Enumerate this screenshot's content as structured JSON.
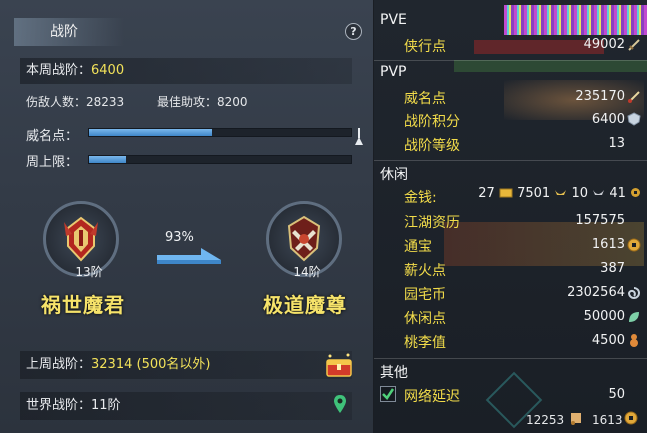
{
  "left": {
    "title": "战阶",
    "help_label": "?",
    "weekly_label": "本周战阶：",
    "weekly_value": "6400",
    "enemies_text": "伤敌人数：28233",
    "assist_text": "最佳助攻：8200",
    "fame_label": "威名点：",
    "fame_fill": 0.47,
    "cap_label": "周上限：",
    "cap_fill": 0.14,
    "current_rank_level": "13阶",
    "current_rank_name": "祸世魔君",
    "progress_pct": "93%",
    "next_rank_level": "14阶",
    "next_rank_name": "极道魔尊",
    "last_week_label": "上周战阶：",
    "last_week_value": "32314 (500名以外)",
    "world_label": "世界战阶：",
    "world_value": "11阶"
  },
  "right": {
    "pve": {
      "header": "PVE",
      "items": [
        {
          "label": "侠行点",
          "value": "49002",
          "icon": "sword-icon"
        }
      ]
    },
    "pvp": {
      "header": "PVP",
      "items": [
        {
          "label": "威名点",
          "value": "235170",
          "icon": "blade-icon"
        },
        {
          "label": "战阶积分",
          "value": "6400",
          "icon": "crest-icon"
        },
        {
          "label": "战阶等级",
          "value": "13",
          "icon": ""
        }
      ]
    },
    "leisure": {
      "header": "休闲",
      "money_label": "金钱:",
      "money_gold": "27",
      "money_silver": "7501",
      "money_copper": "10",
      "money_other": "41",
      "items": [
        {
          "label": "江湖资历",
          "value": "157575",
          "icon": ""
        },
        {
          "label": "通宝",
          "value": "1613",
          "icon": "coin-icon"
        },
        {
          "label": "薪火点",
          "value": "387",
          "icon": ""
        },
        {
          "label": "园宅币",
          "value": "2302564",
          "icon": "swirl-icon"
        },
        {
          "label": "休闲点",
          "value": "50000",
          "icon": "leaf-icon"
        },
        {
          "label": "桃李值",
          "value": "4500",
          "icon": "gourd-icon"
        }
      ]
    },
    "other": {
      "header": "其他",
      "items": [
        {
          "label": "网络延迟",
          "value": "50",
          "checked": true
        }
      ]
    },
    "footer": {
      "left_value": "12253",
      "right_value": "1613"
    }
  },
  "colors": {
    "accent_yellow": "#f2dc4a",
    "bar_blue": "#4a90d0",
    "panel_bg": "#333b47"
  }
}
